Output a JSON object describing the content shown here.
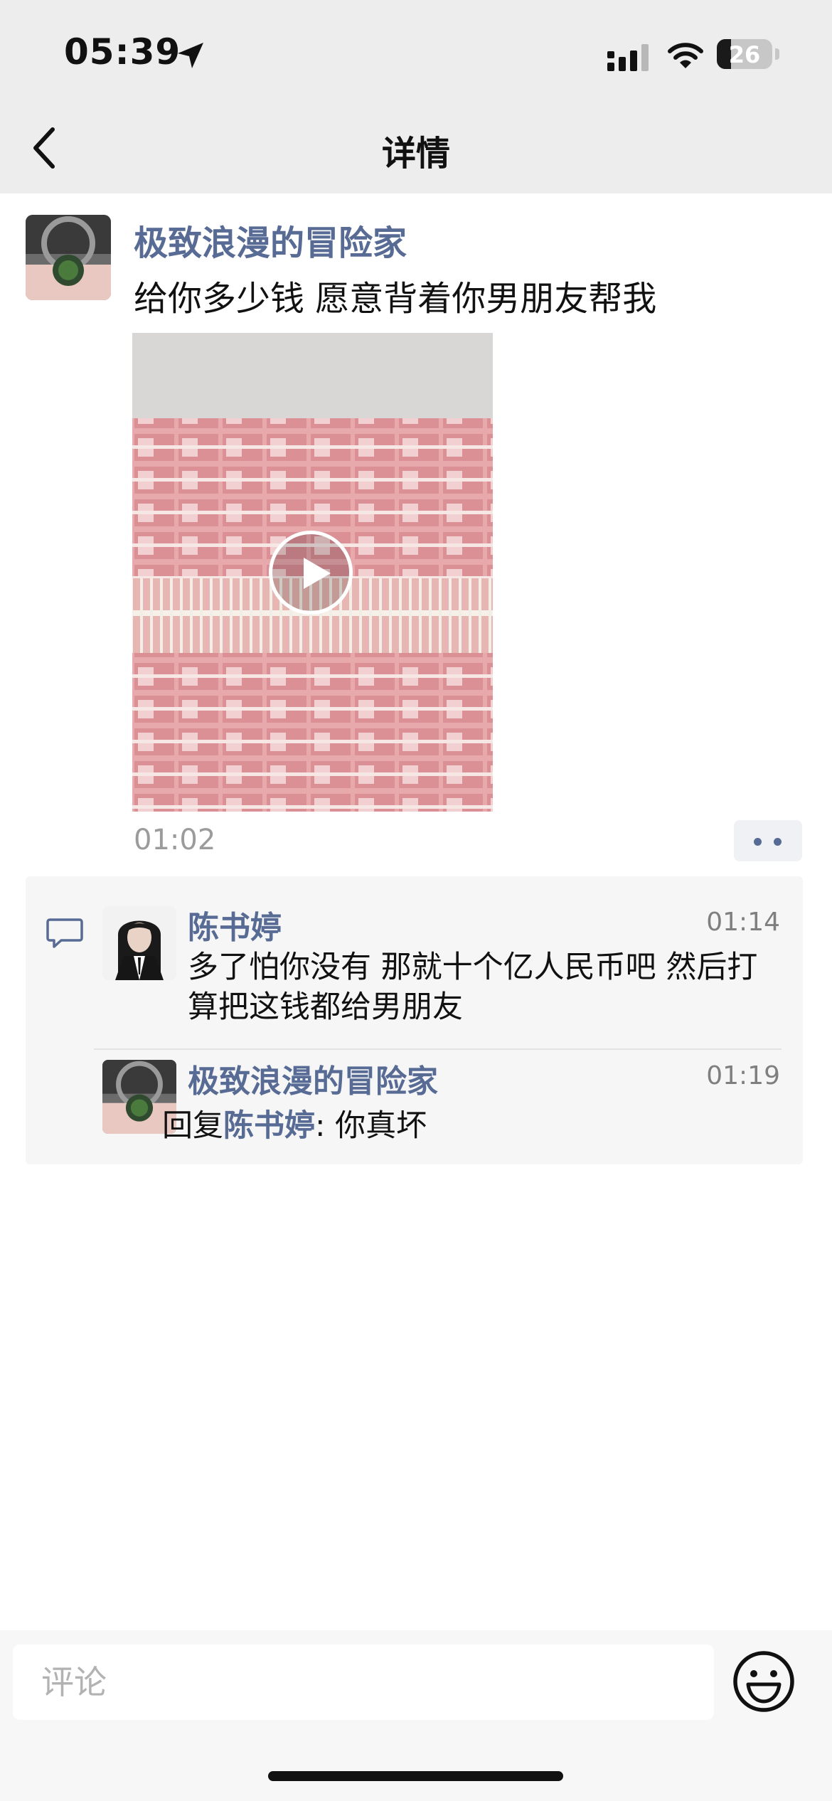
{
  "status_bar": {
    "time": "05:39",
    "battery_level": "26",
    "battery_fraction": 0.26,
    "location_icon": "location-arrow-icon",
    "signal_icon": "cellular-signal-icon",
    "wifi_icon": "wifi-icon"
  },
  "nav": {
    "title": "详情",
    "back_icon": "chevron-left-icon"
  },
  "post": {
    "author": "极致浪漫的冒险家",
    "text": "给你多少钱 愿意背着你男朋友帮我",
    "media_type": "video",
    "play_icon": "play-icon",
    "time": "01:02",
    "more_icon": "two-dots-icon"
  },
  "comments": {
    "section_icon": "comment-bubble-icon",
    "items": [
      {
        "author": "陈书婷",
        "time": "01:14",
        "text": "多了怕你没有 那就十个亿人民币吧  然后打算把这钱都给男朋友"
      },
      {
        "author": "极致浪漫的冒险家",
        "time": "01:19",
        "reply_prefix": "回复",
        "reply_to": "陈书婷",
        "reply_sep": ": ",
        "text": "你真坏"
      }
    ]
  },
  "comment_bar": {
    "placeholder": "评论",
    "emoji_icon": "smiley-face-icon"
  },
  "colors": {
    "link_blue": "#576b95",
    "header_bg": "#ededed",
    "comments_bg": "#f6f6f6",
    "secondary_text": "#9b9b9b"
  }
}
